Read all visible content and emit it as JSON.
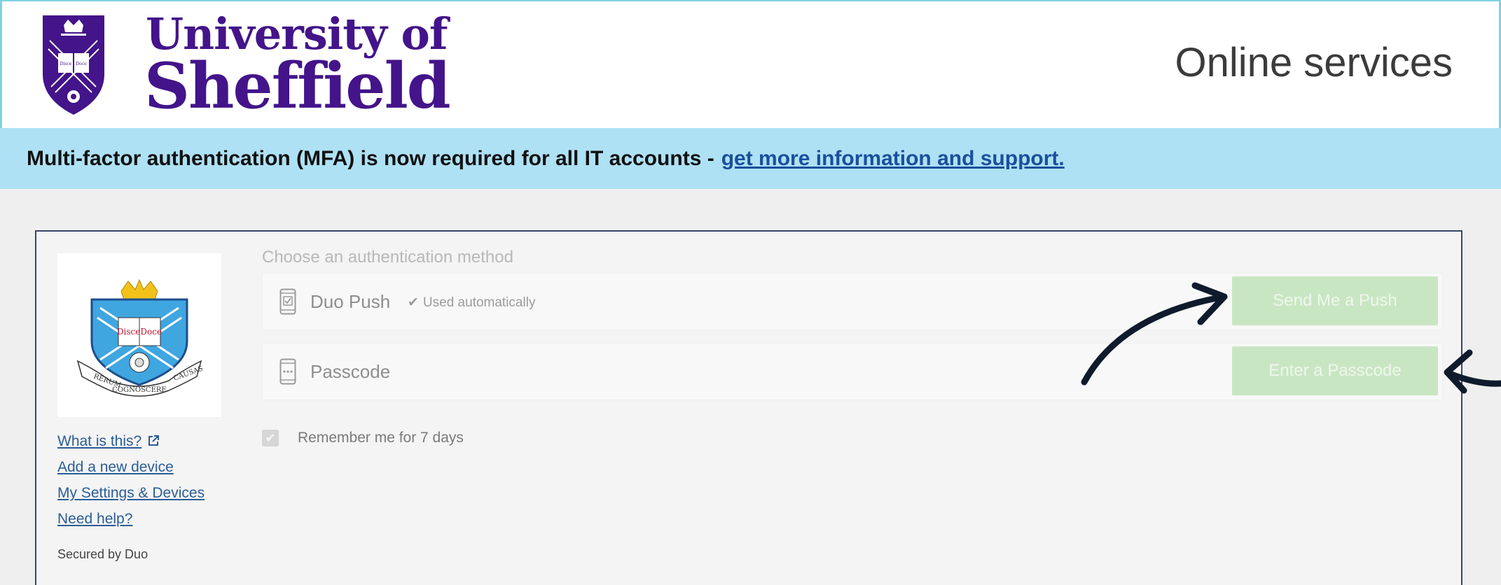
{
  "header": {
    "university_line1": "University of",
    "university_line2": "Sheffield",
    "crest_motto": "Disce Doce",
    "service_title": "Online services"
  },
  "banner": {
    "text": "Multi-factor authentication (MFA) is now required for all IT accounts -",
    "link_text": "get more information and support."
  },
  "logo": {
    "book_text": "DisceDoce",
    "scroll_left": "RERUM",
    "scroll_middle": "COGNOSCERE",
    "scroll_right": "CAUSAS"
  },
  "sidebar": {
    "links": [
      {
        "label": "What is this?",
        "icon": "external-link-icon"
      },
      {
        "label": "Add a new device"
      },
      {
        "label": "My Settings & Devices"
      },
      {
        "label": "Need help?"
      }
    ],
    "secured_by": "Secured by Duo"
  },
  "auth": {
    "choose_label": "Choose an authentication method",
    "methods": [
      {
        "name": "Duo Push",
        "icon": "phone-check-icon",
        "note": "Used automatically",
        "button_label": "Send Me a Push"
      },
      {
        "name": "Passcode",
        "icon": "phone-keypad-icon",
        "button_label": "Enter a Passcode"
      }
    ],
    "remember_label": "Remember me for 7 days",
    "remember_checked": true
  },
  "colors": {
    "brand_purple": "#43148a",
    "banner_bg": "#aee1f4",
    "link_blue": "#1b4f9c",
    "button_green_disabled": "#c9e6c3",
    "annotation_arrow": "#0f1b2d"
  }
}
